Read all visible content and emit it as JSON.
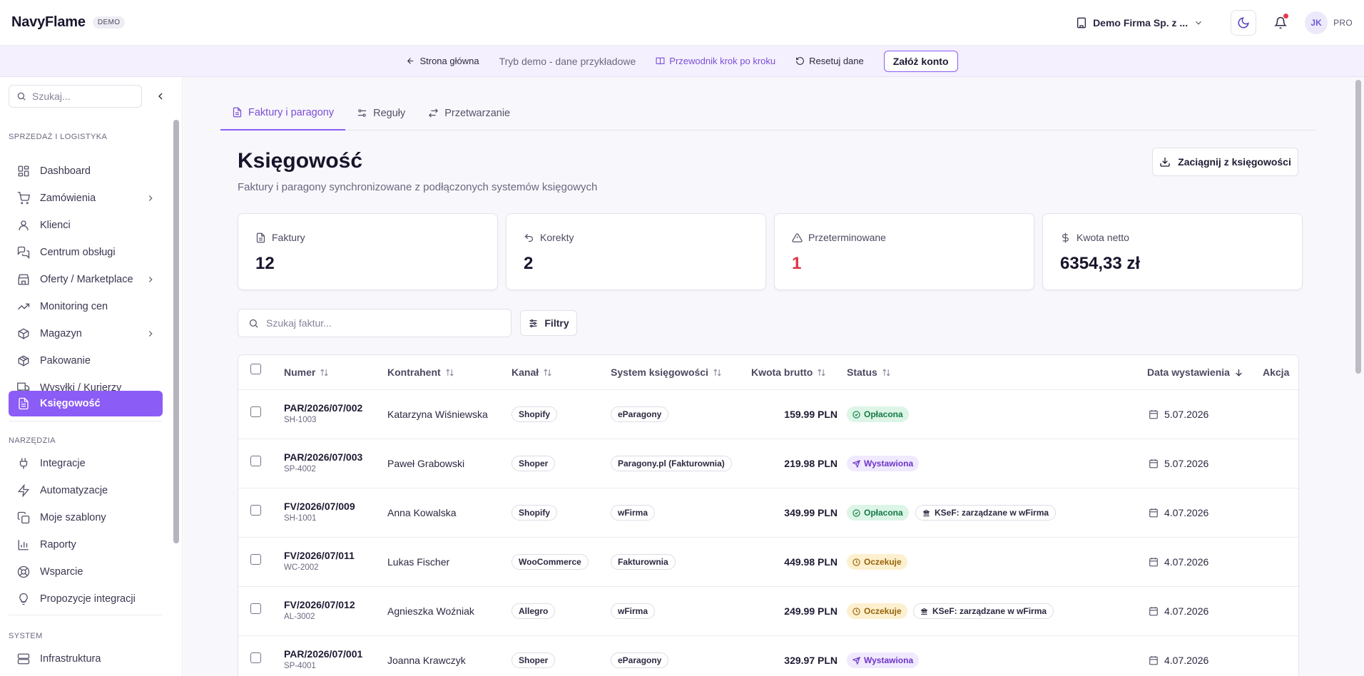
{
  "header": {
    "brand": "NavyFlame",
    "demo_badge": "DEMO",
    "company": "Demo Firma Sp. z ...",
    "avatar": "JK",
    "plan": "PRO"
  },
  "demobar": {
    "home": "Strona główna",
    "mode": "Tryb demo - dane przykładowe",
    "guide": "Przewodnik krok po kroku",
    "reset": "Resetuj dane",
    "create": "Załóż konto"
  },
  "sidebar": {
    "search_placeholder": "Szukaj...",
    "sections": [
      "SPRZEDAŻ I LOGISTYKA",
      "NARZĘDZIA",
      "SYSTEM"
    ],
    "items": [
      {
        "label": "Dashboard",
        "icon": "dashboard-icon"
      },
      {
        "label": "Zamówienia",
        "icon": "cart-icon"
      },
      {
        "label": "Klienci",
        "icon": "user-icon"
      },
      {
        "label": "Centrum obsługi",
        "icon": "chat-icon"
      },
      {
        "label": "Oferty / Marketplace",
        "icon": "store-icon"
      },
      {
        "label": "Monitoring cen",
        "icon": "trend-icon"
      },
      {
        "label": "Magazyn",
        "icon": "box-icon"
      },
      {
        "label": "Pakowanie",
        "icon": "package-icon"
      },
      {
        "label": "Wysyłki / Kurierzy",
        "icon": "truck-icon"
      },
      {
        "label": "Księgowość",
        "icon": "receipt-icon"
      },
      {
        "label": "Integracje",
        "icon": "plug-icon"
      },
      {
        "label": "Automatyzacje",
        "icon": "bolt-icon"
      },
      {
        "label": "Moje szablony",
        "icon": "copy-icon"
      },
      {
        "label": "Raporty",
        "icon": "chart-icon"
      },
      {
        "label": "Wsparcie",
        "icon": "lifebuoy-icon"
      },
      {
        "label": "Propozycje integracji",
        "icon": "lightbulb-icon"
      },
      {
        "label": "Infrastruktura",
        "icon": "server-icon"
      }
    ]
  },
  "tabs": [
    {
      "label": "Faktury i paragony"
    },
    {
      "label": "Reguły"
    },
    {
      "label": "Przetwarzanie"
    }
  ],
  "page": {
    "title": "Księgowość",
    "subtitle": "Faktury i paragony synchronizowane z podłączonych systemów księgowych",
    "pull_button": "Zaciągnij z księgowości"
  },
  "stats": [
    {
      "label": "Faktury",
      "value": "12"
    },
    {
      "label": "Korekty",
      "value": "2"
    },
    {
      "label": "Przeterminowane",
      "value": "1",
      "color": "#dc3545"
    },
    {
      "label": "Kwota netto",
      "value": "6354,33 zł"
    }
  ],
  "search": {
    "placeholder": "Szukaj faktur..."
  },
  "filters_label": "Filtry",
  "table": {
    "headers": [
      "Numer",
      "Kontrahent",
      "Kanał",
      "System księgowości",
      "Kwota brutto",
      "Status",
      "Data wystawienia",
      "Akcja"
    ],
    "rows": [
      {
        "number": "PAR/2026/07/002",
        "ref": "SH-1003",
        "client": "Katarzyna Wiśniewska",
        "channel": "Shopify",
        "system": "eParagony",
        "amount": "159.99 PLN",
        "status": "Opłacona",
        "status_type": "paid",
        "ksef": "",
        "date": "5.07.2026"
      },
      {
        "number": "PAR/2026/07/003",
        "ref": "SP-4002",
        "client": "Paweł Grabowski",
        "channel": "Shoper",
        "system": "Paragony.pl (Fakturownia)",
        "amount": "219.98 PLN",
        "status": "Wystawiona",
        "status_type": "issued",
        "ksef": "",
        "date": "5.07.2026"
      },
      {
        "number": "FV/2026/07/009",
        "ref": "SH-1001",
        "client": "Anna Kowalska",
        "channel": "Shopify",
        "system": "wFirma",
        "amount": "349.99 PLN",
        "status": "Opłacona",
        "status_type": "paid",
        "ksef": "KSeF: zarządzane w wFirma",
        "date": "4.07.2026"
      },
      {
        "number": "FV/2026/07/011",
        "ref": "WC-2002",
        "client": "Lukas Fischer",
        "channel": "WooCommerce",
        "system": "Fakturownia",
        "amount": "449.98 PLN",
        "status": "Oczekuje",
        "status_type": "wait",
        "ksef": "",
        "date": "4.07.2026"
      },
      {
        "number": "FV/2026/07/012",
        "ref": "AL-3002",
        "client": "Agnieszka Woźniak",
        "channel": "Allegro",
        "system": "wFirma",
        "amount": "249.99 PLN",
        "status": "Oczekuje",
        "status_type": "wait",
        "ksef": "KSeF: zarządzane w wFirma",
        "date": "4.07.2026"
      },
      {
        "number": "PAR/2026/07/001",
        "ref": "SP-4001",
        "client": "Joanna Krawczyk",
        "channel": "Shoper",
        "system": "eParagony",
        "amount": "329.97 PLN",
        "status": "Wystawiona",
        "status_type": "issued",
        "ksef": "",
        "date": "4.07.2026"
      }
    ]
  }
}
